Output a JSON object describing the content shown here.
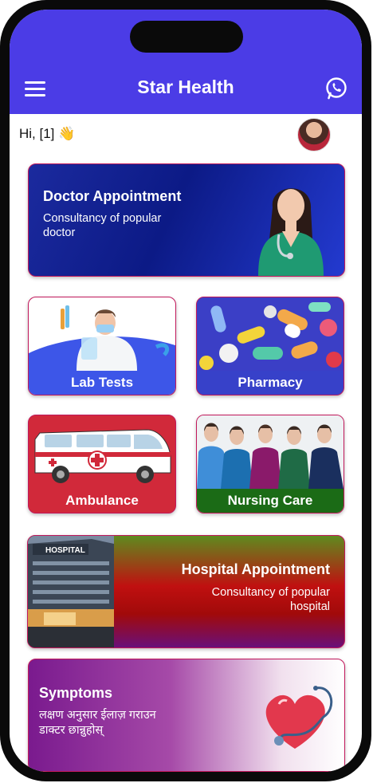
{
  "app": {
    "title": "Star Health"
  },
  "greeting": "Hi, [1] 👋",
  "doctor": {
    "title": "Doctor Appointment",
    "subtitle": "Consultancy of popular doctor"
  },
  "tiles": {
    "lab": "Lab Tests",
    "pharmacy": "Pharmacy",
    "ambulance": "Ambulance",
    "nursing": "Nursing Care"
  },
  "hospital": {
    "title": "Hospital Appointment",
    "subtitle": "Consultancy of popular hospital",
    "sign": "HOSPITAL"
  },
  "symptoms": {
    "title": "Symptoms",
    "subtitle": "लक्षण अनुसार ईलाज़ गराउन डाक्टर छान्नुहोस्"
  },
  "colors": {
    "appbar": "#4b3ce6",
    "border": "#c2185b",
    "nursing_label": "#1b6b16",
    "ambulance": "#d1293a"
  },
  "icons": {
    "menu": "hamburger-menu-icon",
    "whatsapp": "whatsapp-icon"
  }
}
